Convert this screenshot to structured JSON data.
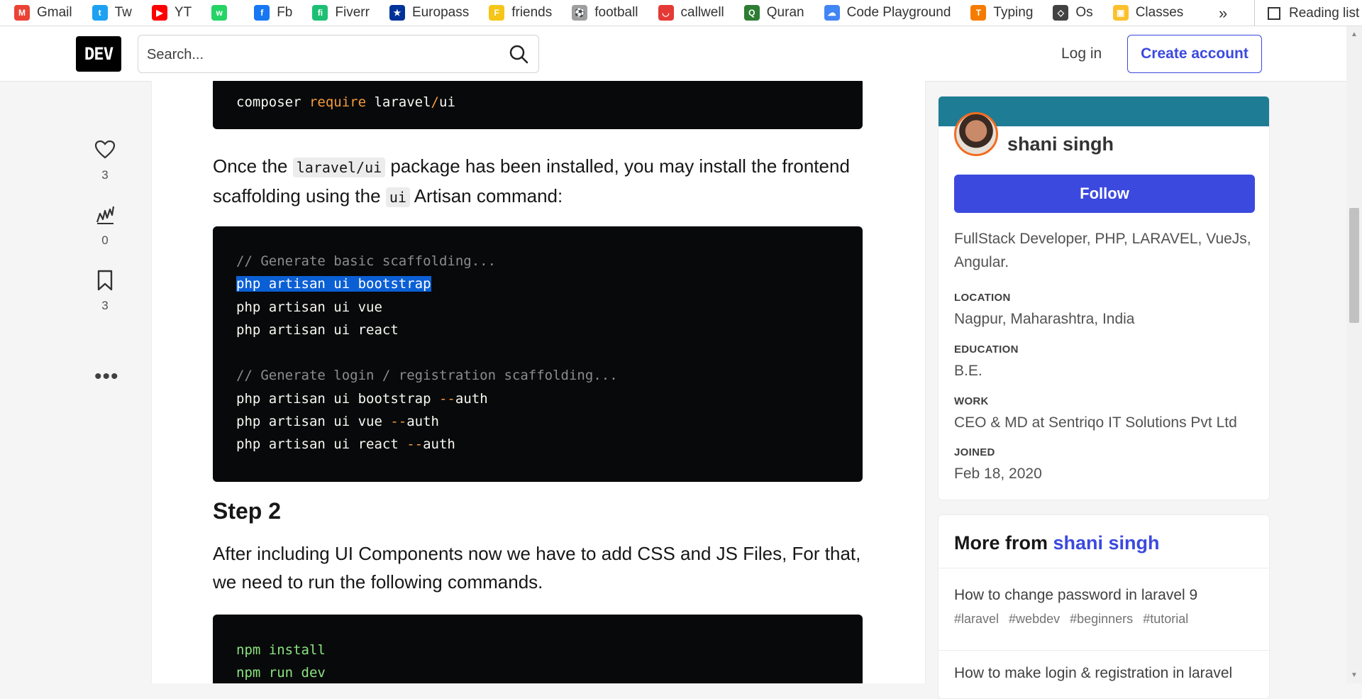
{
  "bookmarks": [
    {
      "label": "Gmail",
      "icon": "gmail-icon",
      "color": "#ea4335",
      "glyph": "M"
    },
    {
      "label": "Tw",
      "icon": "twitter-icon",
      "color": "#1da1f2",
      "glyph": "t"
    },
    {
      "label": "YT",
      "icon": "youtube-icon",
      "color": "#ff0000",
      "glyph": "▶"
    },
    {
      "label": "",
      "icon": "whatsapp-icon",
      "color": "#25d366",
      "glyph": "w"
    },
    {
      "label": "Fb",
      "icon": "facebook-icon",
      "color": "#1877f2",
      "glyph": "f"
    },
    {
      "label": "Fiverr",
      "icon": "fiverr-icon",
      "color": "#1dbf73",
      "glyph": "fi"
    },
    {
      "label": "Europass",
      "icon": "europass-icon",
      "color": "#003399",
      "glyph": "★"
    },
    {
      "label": "friends",
      "icon": "friends-icon",
      "color": "#f5c518",
      "glyph": "F"
    },
    {
      "label": "football",
      "icon": "football-icon",
      "color": "#9e9e9e",
      "glyph": "⚽"
    },
    {
      "label": "callwell",
      "icon": "callwell-icon",
      "color": "#e53935",
      "glyph": "◡"
    },
    {
      "label": "Quran",
      "icon": "quran-icon",
      "color": "#2e7d32",
      "glyph": "Q"
    },
    {
      "label": "Code Playground",
      "icon": "code-playground-icon",
      "color": "#4285f4",
      "glyph": "☁"
    },
    {
      "label": "Typing",
      "icon": "typing-icon",
      "color": "#f57c00",
      "glyph": "T"
    },
    {
      "label": "Os",
      "icon": "os-icon",
      "color": "#424242",
      "glyph": "◇"
    },
    {
      "label": "Classes",
      "icon": "classes-icon",
      "color": "#fbc02d",
      "glyph": "▣"
    }
  ],
  "bookmarks_more": "»",
  "reading_list": "Reading list",
  "header": {
    "logo": "DEV",
    "search_placeholder": "Search...",
    "login": "Log in",
    "create_account": "Create account"
  },
  "reactions": [
    {
      "icon": "heart-icon",
      "count": "3"
    },
    {
      "icon": "unicorn-icon",
      "count": "0"
    },
    {
      "icon": "bookmark-icon",
      "count": "3"
    }
  ],
  "more_actions": "•••",
  "article": {
    "code1": [
      [
        {
          "t": "composer ",
          "c": ""
        },
        {
          "t": "require ",
          "c": "kw"
        },
        {
          "t": "laravel",
          "c": ""
        },
        {
          "t": "/",
          "c": "kw"
        },
        {
          "t": "ui",
          "c": ""
        }
      ]
    ],
    "para1": {
      "a": "Once the ",
      "c1": "laravel/ui",
      "b": " package has been installed, you may install the frontend scaffolding using the ",
      "c2": "ui",
      "d": " Artisan command:"
    },
    "code2": [
      [
        {
          "t": "// Generate basic scaffolding...",
          "c": "cm"
        }
      ],
      [
        {
          "t": "php artisan ui bootstrap",
          "c": "sel"
        }
      ],
      [
        {
          "t": "php artisan ui vue",
          "c": ""
        }
      ],
      [
        {
          "t": "php artisan ui react",
          "c": ""
        }
      ],
      [
        {
          "t": "",
          "c": ""
        }
      ],
      [
        {
          "t": "// Generate login / registration scaffolding...",
          "c": "cm"
        }
      ],
      [
        {
          "t": "php artisan ui bootstrap ",
          "c": ""
        },
        {
          "t": "--",
          "c": "kw"
        },
        {
          "t": "auth",
          "c": ""
        }
      ],
      [
        {
          "t": "php artisan ui vue ",
          "c": ""
        },
        {
          "t": "--",
          "c": "kw"
        },
        {
          "t": "auth",
          "c": ""
        }
      ],
      [
        {
          "t": "php artisan ui react ",
          "c": ""
        },
        {
          "t": "--",
          "c": "kw"
        },
        {
          "t": "auth",
          "c": ""
        }
      ]
    ],
    "step_heading": "Step 2",
    "para2": "After including UI Components now we have to add CSS and JS Files, For that, we need to run the following commands.",
    "code3": [
      [
        {
          "t": "npm install",
          "c": "gr"
        }
      ],
      [
        {
          "t": "npm run dev",
          "c": "gr"
        }
      ]
    ]
  },
  "author": {
    "name": "shani singh",
    "follow": "Follow",
    "bio": "FullStack Developer, PHP, LARAVEL, VueJs, Angular.",
    "fields": [
      {
        "label": "LOCATION",
        "value": "Nagpur, Maharashtra, India"
      },
      {
        "label": "EDUCATION",
        "value": "B.E."
      },
      {
        "label": "WORK",
        "value": "CEO & MD at Sentriqo IT Solutions Pvt Ltd"
      },
      {
        "label": "JOINED",
        "value": "Feb 18, 2020"
      }
    ]
  },
  "more_from": {
    "prefix": "More from ",
    "author_link": "shani singh",
    "items": [
      {
        "title": "How to change password in laravel 9",
        "tags": [
          "#laravel",
          "#webdev",
          "#beginners",
          "#tutorial"
        ]
      },
      {
        "title": "How to make login & registration in laravel",
        "tags": []
      }
    ]
  },
  "colors": {
    "accent": "#3b49df",
    "brand_band": "#1e7c95",
    "code_bg": "#08090a"
  }
}
